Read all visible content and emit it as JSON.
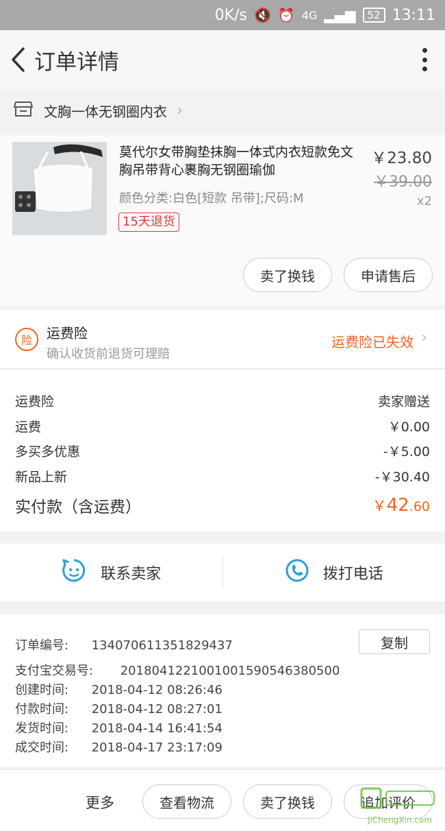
{
  "status_bar": {
    "speed": "0K/s",
    "network": "4G",
    "battery": "52",
    "time": "13:11"
  },
  "header": {
    "title": "订单详情"
  },
  "shop": {
    "name": "文胸一体无钢圈内衣"
  },
  "product": {
    "title": "莫代尔女带胸垫抹胸一体式内衣短款免文胸吊带背心裹胸无钢圈瑜伽",
    "sku": "颜色分类:白色[短款 吊带];尺码:M",
    "tag": "15天退货",
    "price": "￥23.80",
    "original_price": "￥39.00",
    "quantity": "x2",
    "actions": [
      "卖了换钱",
      "申请售后"
    ]
  },
  "insurance": {
    "icon_text": "险",
    "title": "运费险",
    "desc": "确认收货前退货可理赔",
    "status": "运费险已失效"
  },
  "fees": [
    {
      "label": "运费险",
      "value": "卖家赠送"
    },
    {
      "label": "运费",
      "value": "￥0.00"
    },
    {
      "label": "多买多优惠",
      "value": "-￥5.00"
    },
    {
      "label": "新品上新",
      "value": "-￥30.40"
    }
  ],
  "total": {
    "label": "实付款（含运费）",
    "currency": "￥",
    "integer": "42",
    "decimal": ".60"
  },
  "contact": {
    "seller": "联系卖家",
    "phone": "拨打电话"
  },
  "order_info": {
    "copy_label": "复制",
    "rows": [
      {
        "label": "订单编号:",
        "value": "134070611351829437"
      },
      {
        "label": "支付宝交易号:",
        "value": "2018041221001001590546380500"
      },
      {
        "label": "创建时间:",
        "value": "2018-04-12 08:26:46"
      },
      {
        "label": "付款时间:",
        "value": "2018-04-12 08:27:01"
      },
      {
        "label": "发货时间:",
        "value": "2018-04-14 16:41:54"
      },
      {
        "label": "成交时间:",
        "value": "2018-04-17 23:17:09"
      }
    ]
  },
  "bottom_bar": {
    "more": "更多",
    "buttons": [
      "查看物流",
      "卖了换钱",
      "追加评价"
    ]
  },
  "watermark": {
    "text": "JiChengXin.com"
  },
  "colors": {
    "accent": "#f0641e",
    "tag_red": "#e0393e",
    "contact_blue": "#2a9fd6"
  }
}
